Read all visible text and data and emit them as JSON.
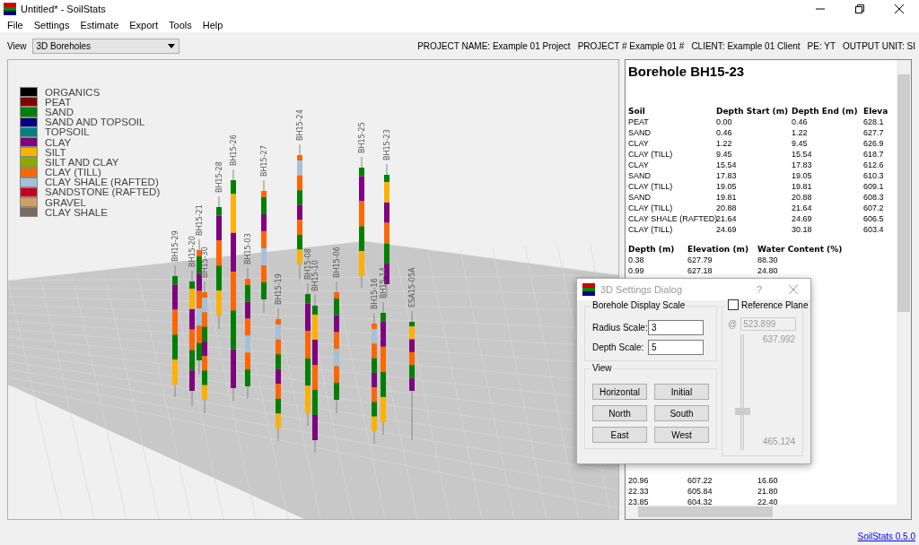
{
  "window": {
    "title": "Untitled* - SoilStats"
  },
  "menu": [
    "File",
    "Settings",
    "Estimate",
    "Export",
    "Tools",
    "Help"
  ],
  "view_selector": {
    "label": "View",
    "value": "3D Boreholes"
  },
  "project_info": [
    "PROJECT NAME: Example 01 Project",
    "PROJECT # Example 01 #",
    "CLIENT: Example 01 Client",
    "PE: YT",
    "OUTPUT UNIT: SI"
  ],
  "legend": [
    {
      "label": "ORGANICS",
      "color": "#000000"
    },
    {
      "label": "PEAT",
      "color": "#800000"
    },
    {
      "label": "SAND",
      "color": "#008000"
    },
    {
      "label": "SAND AND TOPSOIL",
      "color": "#000080"
    },
    {
      "label": "TOPSOIL",
      "color": "#008080"
    },
    {
      "label": "CLAY",
      "color": "#800080"
    },
    {
      "label": "SILT",
      "color": "#ffb000"
    },
    {
      "label": "SILT AND CLAY",
      "color": "#8aa800"
    },
    {
      "label": "CLAY (TILL)",
      "color": "#ff6600"
    },
    {
      "label": "CLAY SHALE (RAFTED)",
      "color": "#a6c0da"
    },
    {
      "label": "SANDSTONE (RAFTED)",
      "color": "#c8001e"
    },
    {
      "label": "GRAVEL",
      "color": "#d0a060"
    },
    {
      "label": "CLAY SHALE",
      "color": "#7a6a60"
    }
  ],
  "boreholes": [
    {
      "label": "BH15-29"
    },
    {
      "label": "BH15-20"
    },
    {
      "label": "BH15-21"
    },
    {
      "label": "BH15-30"
    },
    {
      "label": "BH15-28"
    },
    {
      "label": "BH15-26"
    },
    {
      "label": "BH15-27"
    },
    {
      "label": "BH15-24"
    },
    {
      "label": "BH15-25"
    },
    {
      "label": "BH15-23"
    },
    {
      "label": "BH15-03"
    },
    {
      "label": "BH15-19"
    },
    {
      "label": "BH15-08"
    },
    {
      "label": "BH15-10"
    },
    {
      "label": "BH15-06"
    },
    {
      "label": "BH15-16"
    },
    {
      "label": "BH15-14"
    },
    {
      "label": "ESA15-05A"
    }
  ],
  "detail": {
    "title": "Borehole BH15-23",
    "soil_table": {
      "columns": [
        "Soil",
        "Depth Start (m)",
        "Depth End (m)",
        "Eleva"
      ],
      "rows": [
        [
          "PEAT",
          "0.00",
          "0.46",
          "628.1"
        ],
        [
          "SAND",
          "0.46",
          "1.22",
          "627.7"
        ],
        [
          "CLAY",
          "1.22",
          "9.45",
          "626.9"
        ],
        [
          "CLAY (TILL)",
          "9.45",
          "15.54",
          "618.7"
        ],
        [
          "CLAY",
          "15.54",
          "17.83",
          "612.6"
        ],
        [
          "SAND",
          "17.83",
          "19.05",
          "610.3"
        ],
        [
          "CLAY (TILL)",
          "19.05",
          "19.81",
          "609.1"
        ],
        [
          "SAND",
          "19.81",
          "20.88",
          "608.3"
        ],
        [
          "CLAY (TILL)",
          "20.88",
          "21.64",
          "607.2"
        ],
        [
          "CLAY SHALE (RAFTED)",
          "21.64",
          "24.69",
          "606.5"
        ],
        [
          "CLAY (TILL)",
          "24.69",
          "30.18",
          "603.4"
        ]
      ]
    },
    "water_table": {
      "columns": [
        "Depth (m)",
        "Elevation (m)",
        "Water Content (%)"
      ],
      "rows": [
        [
          "0.38",
          "627.79",
          "88.30"
        ],
        [
          "0.99",
          "627.18",
          "24.80"
        ]
      ],
      "rows_below_dialog": [
        [
          "20.96",
          "607.22",
          "16.60"
        ],
        [
          "22.33",
          "605.84",
          "21.80"
        ],
        [
          "23.85",
          "604.32",
          "22.40"
        ]
      ]
    }
  },
  "dialog": {
    "title": "3D Settings Dialog",
    "help": "?",
    "scale_group": {
      "title": "Borehole Display Scale",
      "fields": [
        {
          "label": "Radius Scale:",
          "value": "3"
        },
        {
          "label": "Depth Scale:",
          "value": "5"
        }
      ]
    },
    "view_group": {
      "title": "View",
      "buttons": [
        "Horizontal",
        "Initial",
        "North",
        "South",
        "East",
        "West"
      ]
    },
    "reference_plane": {
      "label": "Reference Plane",
      "checked": false,
      "at": "@",
      "value": "523.899",
      "max": "637.992",
      "min": "465.124",
      "level": 0.33
    }
  },
  "status_bar": {
    "link": "SoilStats 0.5.0"
  }
}
